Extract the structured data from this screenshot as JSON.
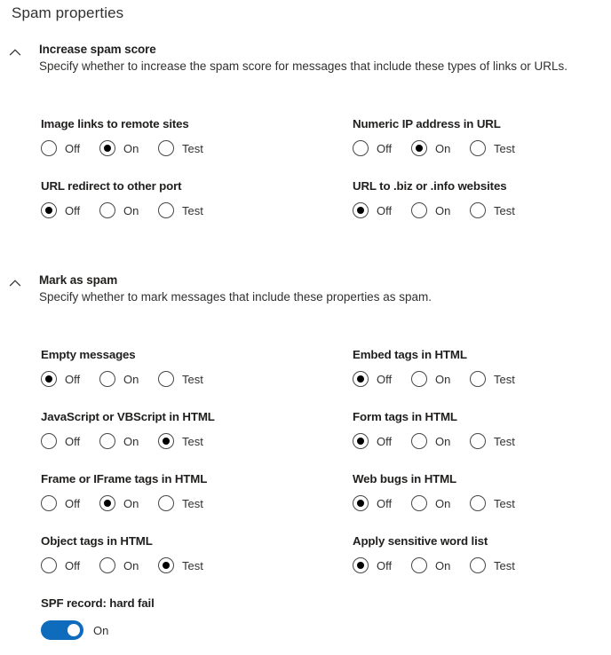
{
  "page": {
    "title": "Spam properties"
  },
  "radio_choices": [
    "Off",
    "On",
    "Test"
  ],
  "sections": [
    {
      "id": "increase-spam-score",
      "chevron_icon": "chevron-up-icon",
      "title": "Increase spam score",
      "description": "Specify whether to increase the spam score for messages that include these types of links or URLs.",
      "options": [
        {
          "label": "Image links to remote sites",
          "selected": "On",
          "column": "left",
          "row": 0
        },
        {
          "label": "Numeric IP address in URL",
          "selected": "On",
          "column": "right",
          "row": 0
        },
        {
          "label": "URL redirect to other port",
          "selected": "Off",
          "column": "left",
          "row": 1
        },
        {
          "label": "URL to .biz or .info websites",
          "selected": "Off",
          "column": "right",
          "row": 1
        }
      ]
    },
    {
      "id": "mark-as-spam",
      "chevron_icon": "chevron-up-icon",
      "title": "Mark as spam",
      "description": "Specify whether to mark messages that include these properties as spam.",
      "options": [
        {
          "label": "Empty messages",
          "selected": "Off",
          "column": "left",
          "row": 0
        },
        {
          "label": "Embed tags in HTML",
          "selected": "Off",
          "column": "right",
          "row": 0
        },
        {
          "label": "JavaScript or VBScript in HTML",
          "selected": "Test",
          "column": "left",
          "row": 1
        },
        {
          "label": "Form tags in HTML",
          "selected": "Off",
          "column": "right",
          "row": 1
        },
        {
          "label": "Frame or IFrame tags in HTML",
          "selected": "On",
          "column": "left",
          "row": 2
        },
        {
          "label": "Web bugs in HTML",
          "selected": "Off",
          "column": "right",
          "row": 2
        },
        {
          "label": "Object tags in HTML",
          "selected": "Test",
          "column": "left",
          "row": 3
        },
        {
          "label": "Apply sensitive word list",
          "selected": "Off",
          "column": "right",
          "row": 3
        }
      ],
      "toggle": {
        "label": "SPF record: hard fail",
        "state_text": "On",
        "checked": true,
        "accent_color": "#0f6cbd"
      }
    }
  ]
}
